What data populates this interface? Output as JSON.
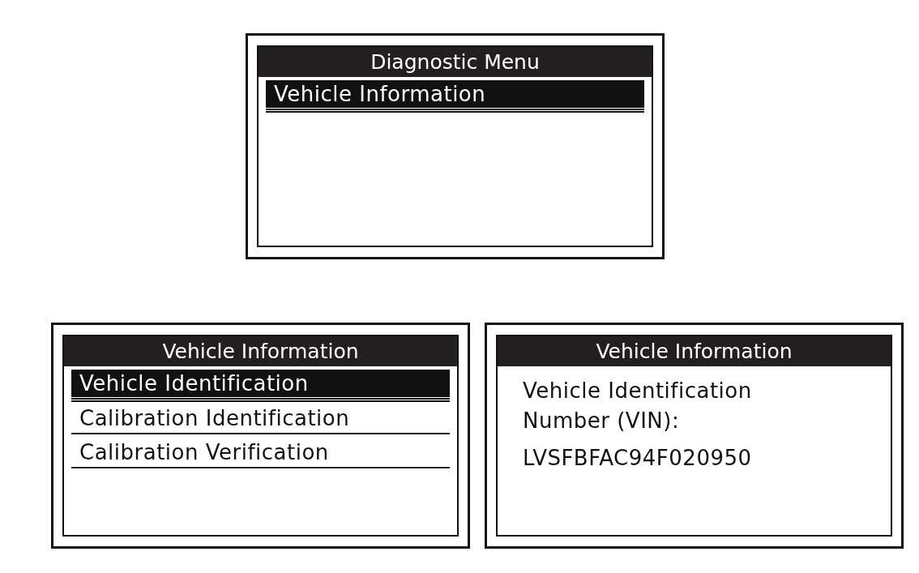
{
  "screens": [
    {
      "title": "Diagnostic Menu",
      "kind": "menu",
      "items": [
        {
          "label": "Vehicle Information",
          "selected": true
        }
      ]
    },
    {
      "title": "Vehicle Information",
      "kind": "menu",
      "items": [
        {
          "label": "Vehicle Identification",
          "selected": true
        },
        {
          "label": "Calibration Identification",
          "selected": false
        },
        {
          "label": "Calibration Verification",
          "selected": false
        }
      ]
    },
    {
      "title": "Vehicle Information",
      "kind": "info",
      "label": "Vehicle Identification Number (VIN):",
      "value": "LVSFBFAC94F020950"
    }
  ]
}
